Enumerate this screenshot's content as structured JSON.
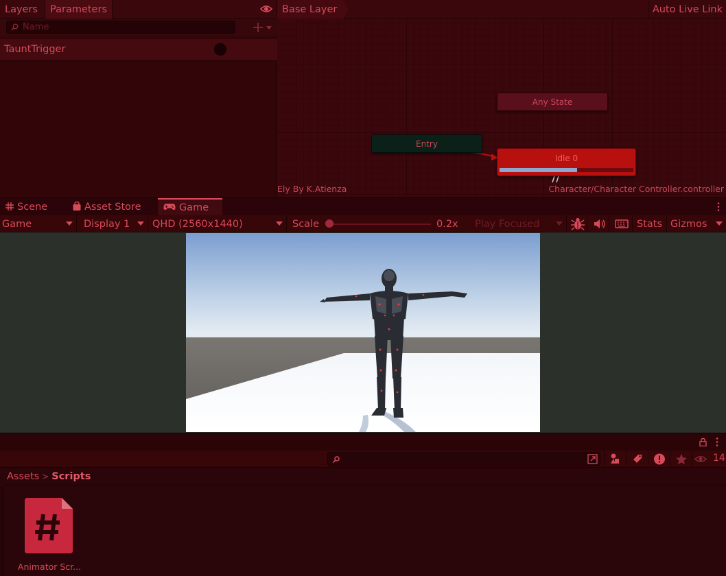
{
  "animator": {
    "tabs": {
      "layers": "Layers",
      "parameters": "Parameters"
    },
    "search_placeholder": "Name",
    "parameters": [
      {
        "name": "TauntTrigger",
        "type": "trigger"
      }
    ],
    "breadcrumb": "Base Layer",
    "auto_live_link": "Auto Live Link",
    "nodes": {
      "any_state": "Any State",
      "entry": "Entry",
      "idle": "Idle 0"
    },
    "idle_progress": 0.58,
    "footer_left": "Ely By K.Atienza",
    "footer_right": "Character/Character Controller.controller"
  },
  "game_tabs": {
    "scene": "Scene",
    "asset_store": "Asset Store",
    "game": "Game"
  },
  "game_toolbar": {
    "view_mode": "Game",
    "display": "Display 1",
    "resolution": "QHD (2560x1440)",
    "scale_label": "Scale",
    "scale_value": "0.2x",
    "scale_fraction": 0.0,
    "play_focused": "Play Focused",
    "stats": "Stats",
    "gizmos": "Gizmos"
  },
  "project": {
    "search_value": "",
    "visible_count": "14",
    "breadcrumb": {
      "root": "Assets",
      "current": "Scripts"
    },
    "assets": [
      {
        "label": "Animator Scr...",
        "icon": "csharp-script-icon"
      }
    ]
  },
  "colors": {
    "accent": "#d64a5a",
    "panel_bg": "#2a0509",
    "idle_node": "#b8100f",
    "entry_node": "#0b2018",
    "script_icon": "#c8283e"
  }
}
